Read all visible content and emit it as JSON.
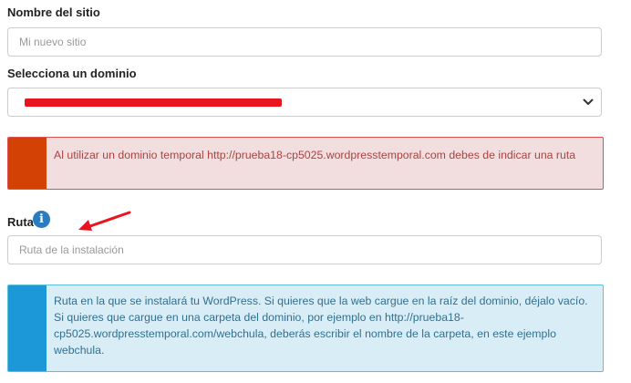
{
  "site_name": {
    "label": "Nombre del sitio",
    "placeholder": "Mi nuevo sitio"
  },
  "domain": {
    "label": "Selecciona un dominio"
  },
  "warning_alert": {
    "text": "Al utilizar un dominio temporal http://prueba18-cp5025.wordpresstemporal.com debes de indicar una ruta"
  },
  "path": {
    "label": "Ruta",
    "icon": "info-icon",
    "placeholder": "Ruta de la instalación"
  },
  "info_alert": {
    "text": "Ruta en la que se instalará tu WordPress. Si quieres que la web cargue en la raíz del dominio, déjalo vacío. Si quieres que cargue en una carpeta del dominio, por ejemplo en http://prueba18-cp5025.wordpresstemporal.com/webchula, deberás escribir el nombre de la carpeta, en este ejemplo webchula."
  },
  "colors": {
    "danger_bar": "#d34204",
    "danger_bg": "#f2dede",
    "info_bar": "#1c98d8",
    "info_bg": "#d9edf7",
    "arrow": "#e8141f"
  }
}
